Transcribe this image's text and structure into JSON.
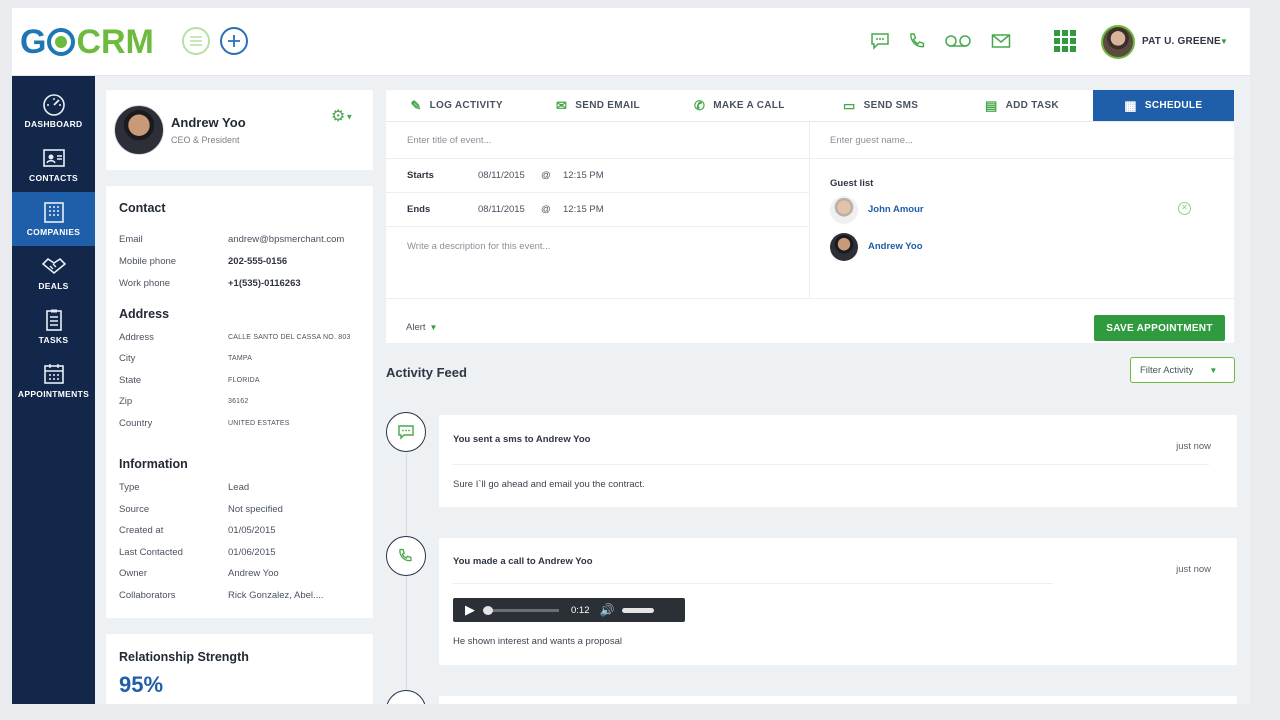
{
  "brand": {
    "name": "GOCRM"
  },
  "topbar": {
    "user_name": "PAT U. GREENE",
    "icons": [
      "chat-icon",
      "phone-icon",
      "voicemail-icon",
      "mail-icon",
      "apps-grid-icon"
    ]
  },
  "sidebar": {
    "items": [
      {
        "label": "DASHBOARD",
        "icon": "speedometer-icon"
      },
      {
        "label": "CONTACTS",
        "icon": "contact-card-icon"
      },
      {
        "label": "COMPANIES",
        "icon": "building-icon",
        "active": true
      },
      {
        "label": "DEALS",
        "icon": "handshake-icon"
      },
      {
        "label": "TASKS",
        "icon": "clipboard-icon"
      },
      {
        "label": "APPOINTMENTS",
        "icon": "calendar-icon"
      }
    ]
  },
  "profile": {
    "name": "Andrew Yoo",
    "title": "CEO & President"
  },
  "contact": {
    "title": "Contact",
    "rows": [
      {
        "label": "Email",
        "value": "andrew@bpsmerchant.com"
      },
      {
        "label": "Mobile phone",
        "value": "202-555-0156"
      },
      {
        "label": "Work phone",
        "value": "+1(535)-0116263"
      }
    ]
  },
  "address": {
    "title": "Address",
    "rows": [
      {
        "label": "Address",
        "value": "CALLE SANTO DEL CASSA NO. 803"
      },
      {
        "label": "City",
        "value": "TAMPA"
      },
      {
        "label": "State",
        "value": "FLORIDA"
      },
      {
        "label": "Zip",
        "value": "36162"
      },
      {
        "label": "Country",
        "value": "UNITED ESTATES"
      }
    ]
  },
  "information": {
    "title": "Information",
    "rows": [
      {
        "label": "Type",
        "value": "Lead"
      },
      {
        "label": "Source",
        "value": "Not specified"
      },
      {
        "label": "Created at",
        "value": "01/05/2015"
      },
      {
        "label": "Last Contacted",
        "value": "01/06/2015"
      },
      {
        "label": "Owner",
        "value": "Andrew Yoo"
      },
      {
        "label": "Collaborators",
        "value": "Rick Gonzalez, Abel...."
      }
    ]
  },
  "relationship": {
    "title": "Relationship Strength",
    "value": "95%"
  },
  "actions": {
    "tabs": [
      {
        "label": "LOG ACTIVITY",
        "icon": "pencil-icon"
      },
      {
        "label": "SEND EMAIL",
        "icon": "send-mail-icon"
      },
      {
        "label": "MAKE A CALL",
        "icon": "phone-icon"
      },
      {
        "label": "SEND SMS",
        "icon": "chat-icon"
      },
      {
        "label": "ADD TASK",
        "icon": "clipboard-icon"
      },
      {
        "label": "SCHEDULE",
        "icon": "calendar-icon",
        "active": true
      }
    ]
  },
  "schedule": {
    "title_placeholder": "Enter title of event...",
    "starts_label": "Starts",
    "starts_date": "08/11/2015",
    "starts_at": "@",
    "starts_time": "12:15 PM",
    "ends_label": "Ends",
    "ends_date": "08/11/2015",
    "ends_at": "@",
    "ends_time": "12:15 PM",
    "description_placeholder": "Write a description for this event...",
    "guest_placeholder": "Enter guest name...",
    "guest_list_label": "Guest list",
    "guests": [
      "John Amour",
      "Andrew Yoo"
    ],
    "alert_label": "Alert",
    "save_label": "SAVE APPOINTMENT"
  },
  "feed": {
    "title": "Activity Feed",
    "filter_label": "Filter Activity",
    "items": [
      {
        "type": "sms",
        "icon": "chat-icon",
        "head": "You sent a sms to Andrew Yoo",
        "time": "just now",
        "body": "Sure I`ll go ahead and email you the contract."
      },
      {
        "type": "call",
        "icon": "phone-icon",
        "head": "You made a call to Andrew Yoo",
        "time": "just now",
        "audio_time": "0:12",
        "body": "He shown interest and wants a proposal"
      }
    ]
  },
  "colors": {
    "navy": "#13274a",
    "blue": "#1f5ea8",
    "green": "#2f9b3e",
    "light_green": "#6dbb3c"
  }
}
